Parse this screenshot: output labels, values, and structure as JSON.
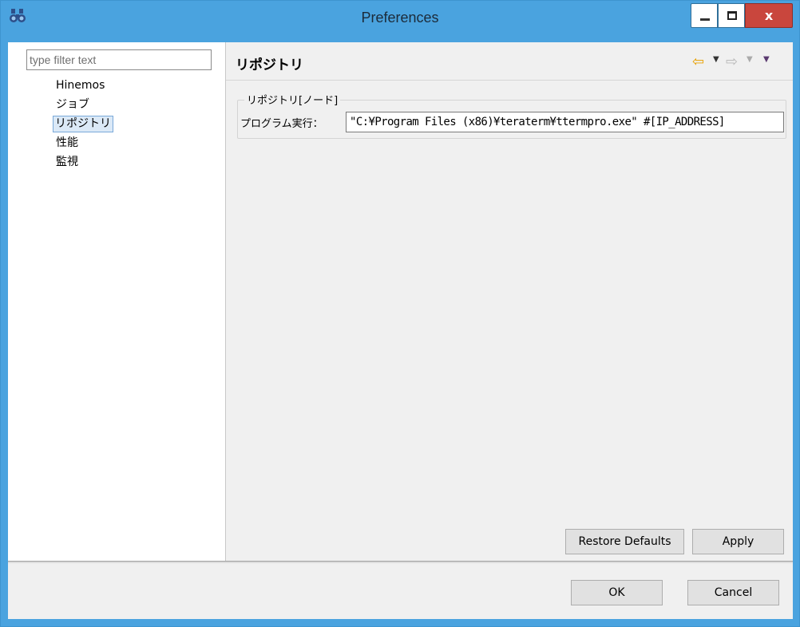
{
  "window": {
    "title": "Preferences",
    "close_label": "x",
    "app_icon": "binoculars-icon",
    "accent_color": "#4aa3df",
    "close_color": "#c9463d"
  },
  "sidebar": {
    "filter_placeholder": "type filter text",
    "items": [
      {
        "label": "Hinemos",
        "selected": false
      },
      {
        "label": "ジョブ",
        "selected": false
      },
      {
        "label": "リポジトリ",
        "selected": true
      },
      {
        "label": "性能",
        "selected": false
      },
      {
        "label": "監視",
        "selected": false
      }
    ]
  },
  "page": {
    "title": "リポジトリ",
    "nav_icons": [
      "back-arrow-icon",
      "dropdown-icon",
      "forward-arrow-icon",
      "dropdown-icon",
      "view-menu-icon"
    ],
    "group": {
      "legend": "リポジトリ[ノード]",
      "label": "プログラム実行：",
      "value": "\"C:¥Program Files (x86)¥teraterm¥ttermpro.exe\" #[IP_ADDRESS]"
    },
    "restore_defaults_label": "Restore Defaults",
    "apply_label": "Apply"
  },
  "footer": {
    "ok_label": "OK",
    "cancel_label": "Cancel"
  }
}
